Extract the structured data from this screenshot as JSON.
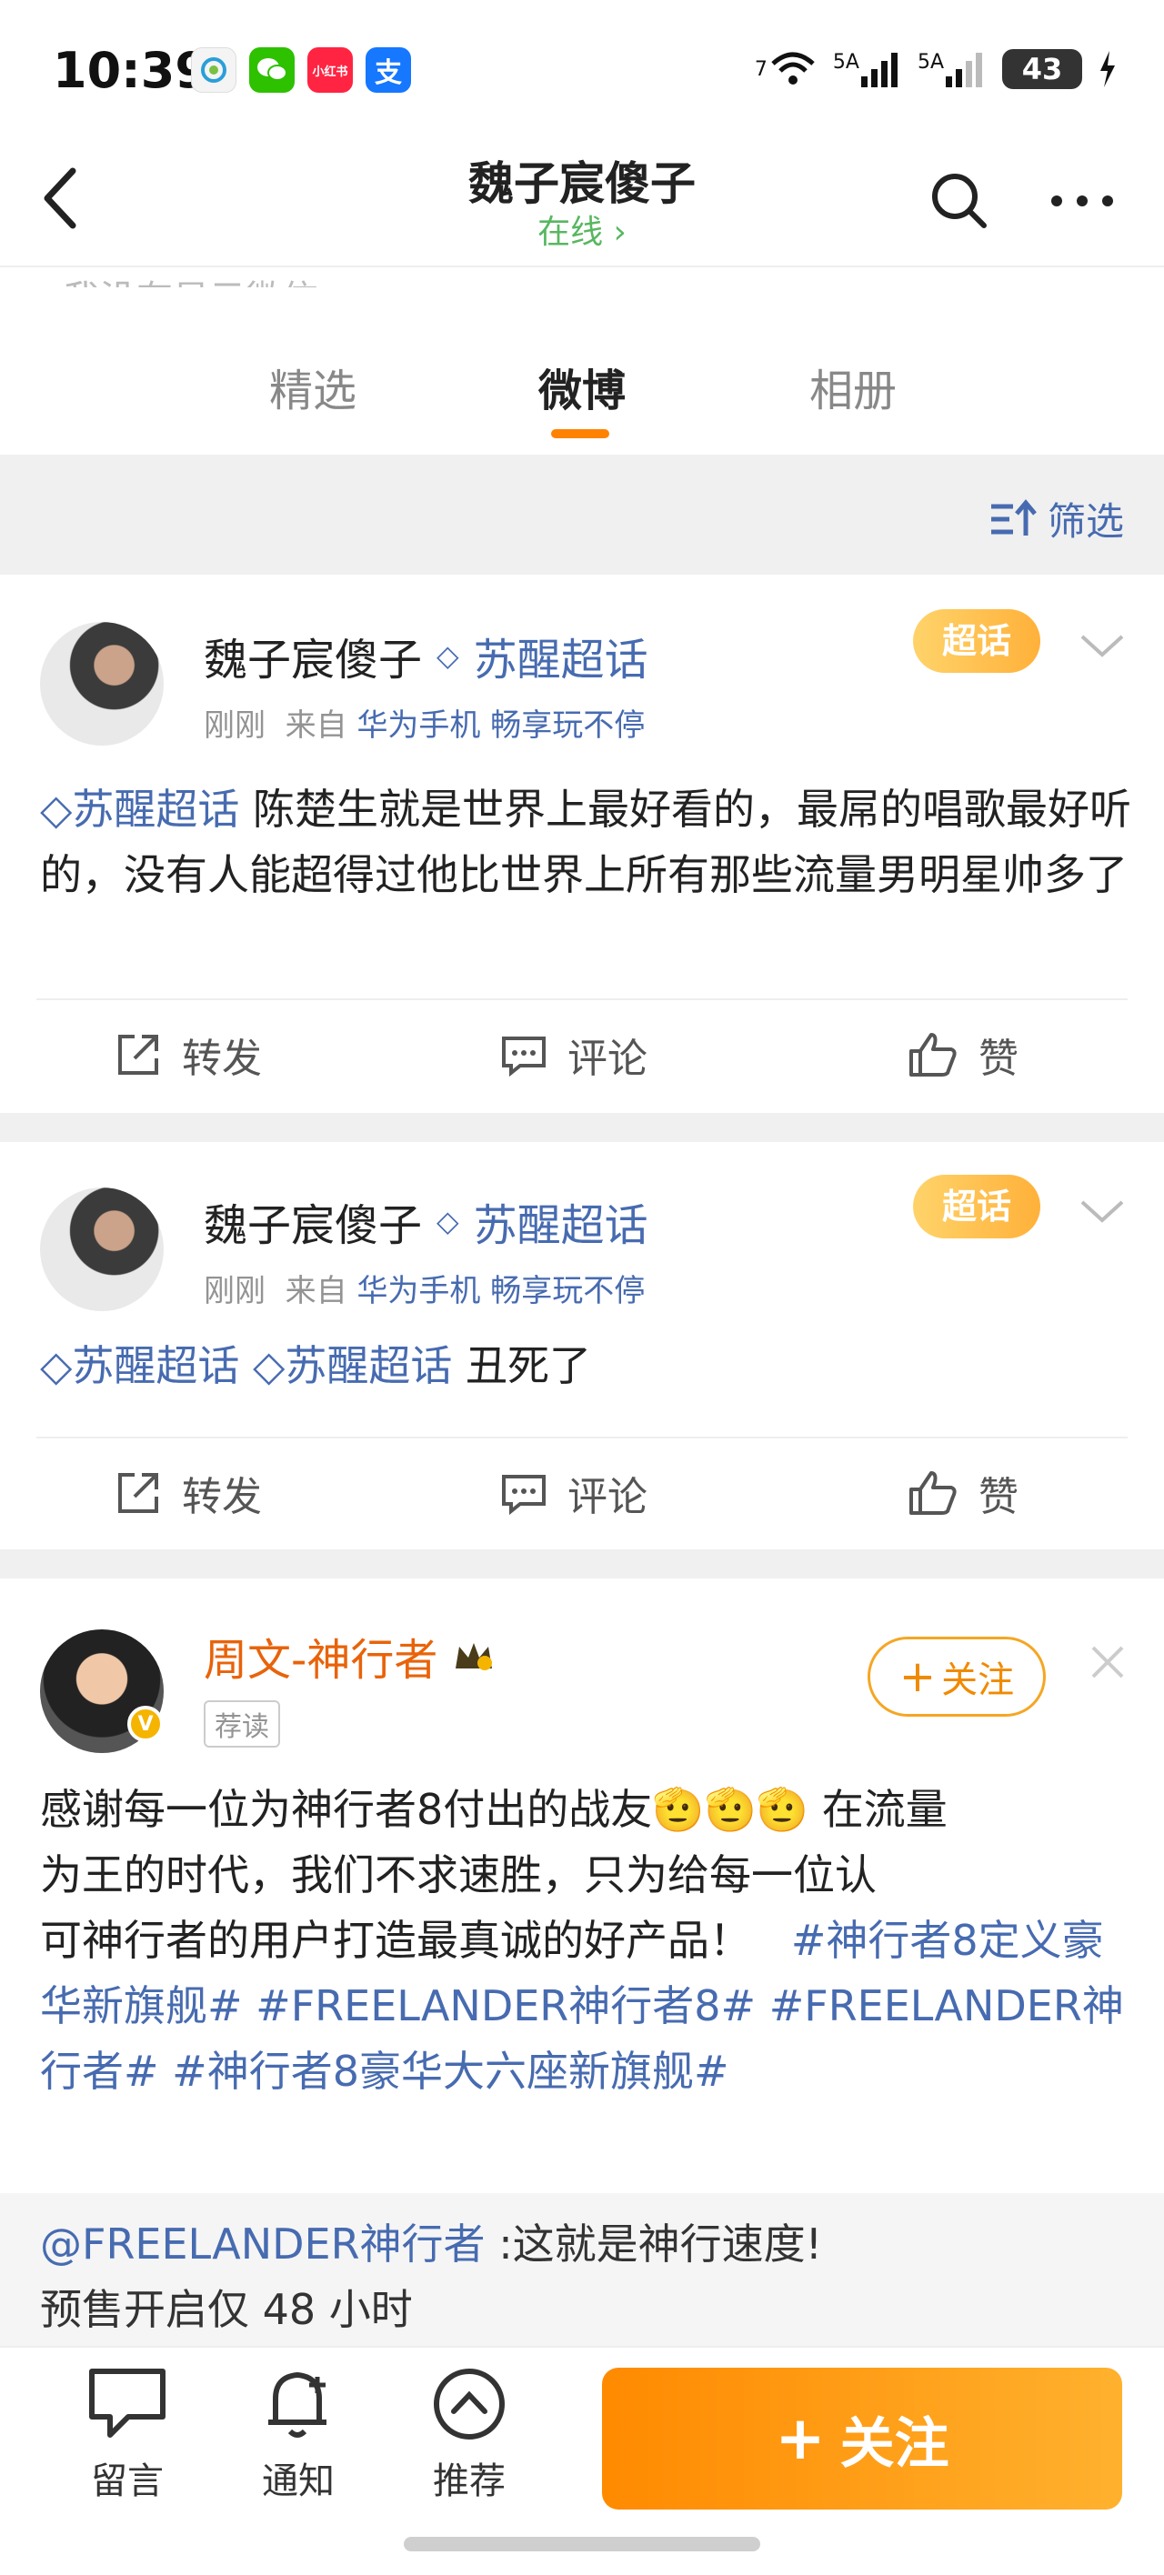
{
  "status_bar": {
    "time": "10:39",
    "apps": [
      {
        "name": "China Mobile",
        "color": "#f4f4f4",
        "glyph": ""
      },
      {
        "name": "WeChat",
        "color": "#2dc100",
        "glyph": ""
      },
      {
        "name": "Xiaohongshu",
        "color": "#ff2442",
        "glyph": "小红书"
      },
      {
        "name": "Alipay",
        "color": "#1677ff",
        "glyph": "支"
      }
    ],
    "network_wifi": "7",
    "sim1": "5A",
    "sim2": "5A",
    "battery": "43"
  },
  "header": {
    "title": "魏子宸傻子",
    "status": "在线 ›"
  },
  "peek_text": "我没有显示微信",
  "tabs": [
    "精选",
    "微博",
    "相册"
  ],
  "active_tab": "微博",
  "filter_label": "筛选",
  "posts": [
    {
      "user": "魏子宸傻子",
      "topic_tag": "苏醒超话",
      "time": "刚刚",
      "from_label": "来自",
      "source": "华为手机 畅享玩不停",
      "badge": "超话",
      "topic": "苏醒超话",
      "text": "陈楚生就是世界上最好看的，最屌的唱歌最好听的，没有人能超得过他比世界上所有那些流量男明星帅多了",
      "actions": [
        "转发",
        "评论",
        "赞"
      ]
    },
    {
      "user": "魏子宸傻子",
      "topic_tag": "苏醒超话",
      "time": "刚刚",
      "from_label": "来自",
      "source": "华为手机 畅享玩不停",
      "badge": "超话",
      "topic1": "苏醒超话",
      "topic2": "苏醒超话",
      "text": "丑死了",
      "actions": [
        "转发",
        "评论",
        "赞"
      ]
    },
    {
      "user": "周文-神行者",
      "chip": "荐读",
      "follow_label": "关注",
      "text_line1": "感谢每一位为神行者8付出的战友🫡🫡🫡 在流量",
      "text_line2": "为王的时代，我们不求速胜，只为给每一位认",
      "text_line3": "可神行者的用户打造最真诚的好产品！",
      "hashtag1": "#神行者8定义豪华新旗舰#",
      "hashtag2": "#FREELANDER神行者8#",
      "hashtag3": "#FREELANDER神行者#",
      "hashtag4": "#神行者8豪华大六座新旗舰#",
      "repost_user": "@FREELANDER神行者",
      "repost_text": ":这就是神行速度!",
      "repost_line2": "预售开启仅 48 小时"
    }
  ],
  "bottom_bar": {
    "items": [
      "留言",
      "通知",
      "推荐"
    ],
    "follow_button": "关注"
  },
  "colors": {
    "accent_orange": "#ff8200",
    "link_blue": "#476bb0",
    "online_green": "#58b760"
  }
}
